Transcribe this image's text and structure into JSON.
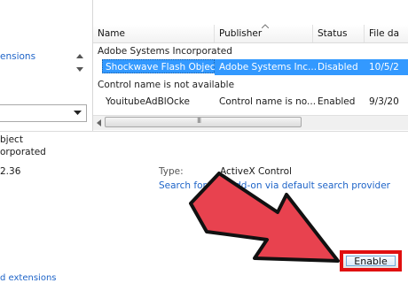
{
  "left_pane": {
    "link_text": "ensions",
    "dropdown_value": ""
  },
  "list": {
    "columns": [
      "Name",
      "Publisher",
      "Status",
      "File da"
    ],
    "groups": [
      {
        "title": "Adobe Systems Incorporated",
        "rows": [
          {
            "name": "Shockwave Flash Object",
            "publisher": "Adobe Systems Inc...",
            "status": "Disabled",
            "file_date": "10/5/2"
          }
        ]
      },
      {
        "title": "Control name is not available",
        "rows": [
          {
            "name": "YouitubeAdBlOcke",
            "publisher": "Control name is no...",
            "status": "Enabled",
            "file_date": "9/3/20"
          }
        ]
      }
    ],
    "hscroll_grip": "III"
  },
  "details": {
    "name_fragment": "bject",
    "publisher_fragment": "orporated",
    "version_fragment": "2.36",
    "type_label": "Type:",
    "type_value": "ActiveX Control",
    "search_link": "Search for this add-on via default search provider"
  },
  "footer": {
    "enable_label": "Enable",
    "bottom_link_fragment": "d extensions"
  },
  "colors": {
    "selection": "#3399ff",
    "link": "#1e64c8",
    "arrow_fill": "#e8424f",
    "highlight_box": "#e01010"
  }
}
